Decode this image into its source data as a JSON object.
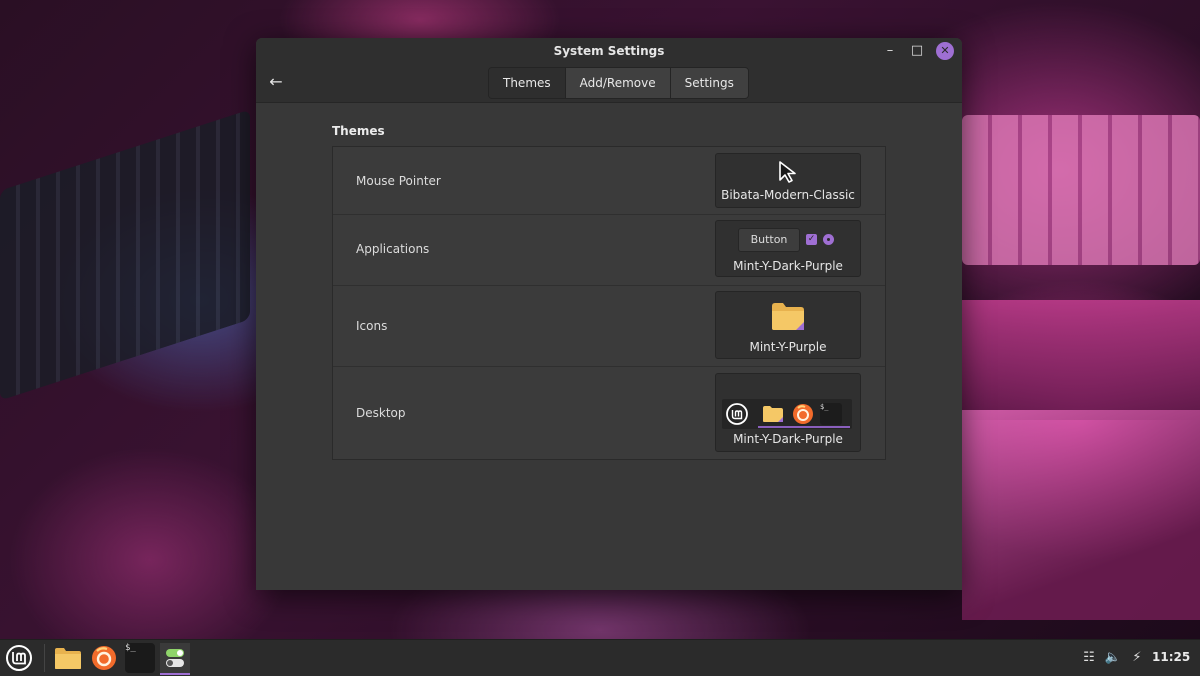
{
  "window": {
    "title": "System Settings",
    "back_label": "←",
    "tabs": [
      {
        "label": "Themes",
        "active": true
      },
      {
        "label": "Add/Remove",
        "active": false
      },
      {
        "label": "Settings",
        "active": false
      }
    ]
  },
  "themes": {
    "section_title": "Themes",
    "rows": [
      {
        "label": "Mouse Pointer",
        "value": "Bibata-Modern-Classic",
        "preview_icon": "cursor-icon"
      },
      {
        "label": "Applications",
        "value": "Mint-Y-Dark-Purple",
        "preview_button_label": "Button"
      },
      {
        "label": "Icons",
        "value": "Mint-Y-Purple",
        "preview_icon": "folder-icon"
      },
      {
        "label": "Desktop",
        "value": "Mint-Y-Dark-Purple"
      }
    ]
  },
  "taskbar": {
    "terminal_glyph": "$_",
    "clock": "11:25"
  },
  "colors": {
    "accent": "#9f6fd3",
    "window_bg": "#383838",
    "titlebar_bg": "#2f2f2f"
  }
}
